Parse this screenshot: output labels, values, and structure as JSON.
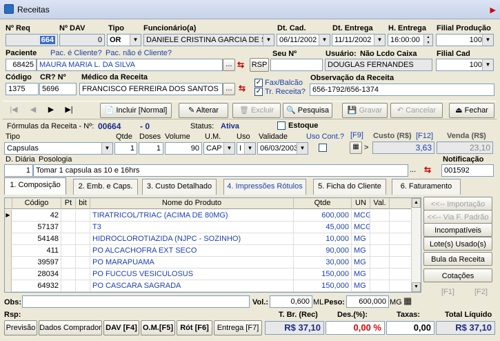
{
  "window": {
    "title": "Receitas"
  },
  "header": {
    "nreq_label": "Nº Req",
    "nreq": "664",
    "ndav_label": "Nº DAV",
    "ndav": "0",
    "tipo_label": "Tipo",
    "tipo": "OR",
    "func_label": "Funcionário(a)",
    "func": "DANIELE CRISTINA GARCIA DE SOUZA",
    "dtcad_label": "Dt. Cad.",
    "dtcad": "06/11/2002",
    "dtent_label": "Dt. Entrega",
    "dtent": "11/11/2002",
    "hent_label": "H. Entrega",
    "hent": "16:00:00",
    "filprod_label": "Filial Produção",
    "filprod": "100",
    "pac_label": "Paciente",
    "pac_link1": "Pac. é Cliente?",
    "pac_link2": "Pac. não é Cliente?",
    "pac_code": "68425",
    "pac_name": "MAURA MARIA L. DA SILVA",
    "rsp_btn": "RSP",
    "seu_label": "Seu Nº",
    "seu": "",
    "usuario_label": "Usuário:",
    "nlc_label": "Não Lcdo Caixa",
    "usuario": "DOUGLAS FERNANDES",
    "filcad_label": "Filial Cad",
    "filcad": "100",
    "codigo_label": "Código",
    "codigo": "1375",
    "cr_label": "CR? Nº",
    "cr": "5696",
    "medico_label": "Médico da Receita",
    "medico": "FRANCISCO FERREIRA DOS SANTOS",
    "fax_label": "Fax/Balcão",
    "tr_label": "Tr. Receita?",
    "obs_rec_label": "Observação da Receita",
    "obs_rec": "656-1792/656-1374",
    "dots": "..."
  },
  "toolbar": {
    "incluir": "Incluir [Normal]",
    "alterar": "Alterar",
    "excluir": "Excluir",
    "pesquisa": "Pesquisa",
    "gravar": "Gravar",
    "cancelar": "Cancelar",
    "fechar": "Fechar"
  },
  "formula": {
    "title": "Fórmulas da Receita - Nº:",
    "num": "00664",
    "dash": "- 0",
    "status_label": "Status:",
    "status": "Ativa",
    "estoque": "Estoque",
    "tipo_label": "Tipo",
    "tipo": "Capsulas",
    "qtde_label": "Qtde",
    "qtde": "1",
    "doses_label": "Doses",
    "doses": "1",
    "volume_label": "Volume",
    "volume": "90",
    "um_label": "U.M.",
    "um": "CAP",
    "uso_label": "Uso",
    "uso": "I",
    "validade_label": "Validade",
    "validade": "06/03/2003",
    "usocont_label": "Uso Cont.?",
    "f9": "[F9]",
    "gt": ">",
    "custo_label": "Custo (R$)",
    "f12": "[F12]",
    "custo": "3,63",
    "venda_label": "Venda (R$)",
    "venda": "23,10",
    "ddiaria_label": "D. Diária",
    "posologia_label": "Posologia",
    "ddiaria": "1",
    "posologia": "Tomar 1 capsula as 10 e 16hrs",
    "notif_label": "Notificação",
    "notif": "001592"
  },
  "tabs": [
    "1. Composição",
    "2. Emb. e Caps.",
    "3. Custo Detalhado",
    "4. Impressões Rótulos",
    "5. Ficha do Cliente",
    "6. Faturamento"
  ],
  "grid": {
    "headers": [
      "Código",
      "Pt",
      "bit",
      "Nome do Produto",
      "Qtde",
      "UN",
      "Val."
    ],
    "rows": [
      {
        "codigo": "42",
        "nome": "TIRATRICOL/TRIAC   (ACIMA DE 80MG)",
        "qtde": "600,000",
        "un": "MCG"
      },
      {
        "codigo": "57137",
        "nome": "T3",
        "qtde": "45,000",
        "un": "MCG"
      },
      {
        "codigo": "54148",
        "nome": "HIDROCLOROTIAZIDA     (NJPC - SOZINHO)",
        "qtde": "10,000",
        "un": "MG"
      },
      {
        "codigo": "411",
        "nome": "PO ALCACHOFRA EXT SECO",
        "qtde": "90,000",
        "un": "MG"
      },
      {
        "codigo": "39597",
        "nome": "PO MARAPUAMA",
        "qtde": "30,000",
        "un": "MG"
      },
      {
        "codigo": "28034",
        "nome": "PO FUCCUS VESICULOSUS",
        "qtde": "150,000",
        "un": "MG"
      },
      {
        "codigo": "64932",
        "nome": "PO CASCARA SAGRADA",
        "qtde": "150,000",
        "un": "MG"
      }
    ]
  },
  "side": {
    "importacao": "<<-- Importação",
    "viapadrao": "<<-- Via F. Padrão",
    "incompat": "Incompatíveis",
    "lotes": "Lote(s) Usado(s)",
    "bula": "Bula da Receita",
    "cotacoes": "Cotações",
    "f1": "[F1]",
    "f2": "[F2]"
  },
  "bottom": {
    "obs_label": "Obs:",
    "obs": "",
    "vol_label": "Vol.:",
    "vol": "0,600",
    "ml": "ML",
    "peso_label": "Peso:",
    "peso": "600,000",
    "mg": "MG",
    "rsp_label": "Rsp:",
    "previsao": "Previsão",
    "dados": "Dados Comprador",
    "dav": "DAV [F4]",
    "om": "O.M.[F5]",
    "rot": "Rót [F6]",
    "entrega": "Entrega [F7]",
    "tbr_label": "T. Br. (Rec)",
    "tbr": "R$ 37,10",
    "des_label": "Des.(%):",
    "des": "0,00 %",
    "taxas_label": "Taxas:",
    "taxas": "0,00",
    "total_label": "Total Líquido",
    "total": "R$ 37,10"
  }
}
